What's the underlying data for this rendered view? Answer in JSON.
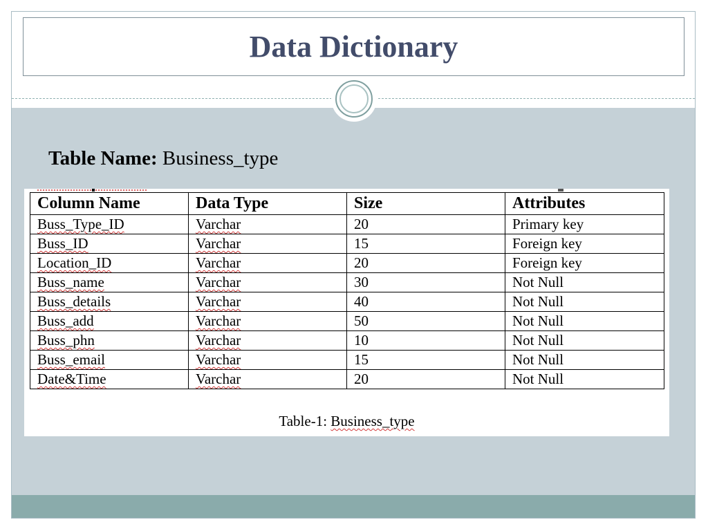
{
  "slide": {
    "title": "Data Dictionary",
    "table_name_label": "Table Name:",
    "table_name_value": "Business_type"
  },
  "table": {
    "headers": [
      "Column Name",
      "Data Type",
      "Size",
      "Attributes"
    ],
    "rows": [
      [
        "Buss_Type_ID",
        "Varchar",
        "20",
        "Primary key"
      ],
      [
        "Buss_ID",
        "Varchar",
        "15",
        "Foreign key"
      ],
      [
        "Location_ID",
        "Varchar",
        "20",
        "Foreign key"
      ],
      [
        "Buss_name",
        "Varchar",
        "30",
        "Not Null"
      ],
      [
        "Buss_details",
        "Varchar",
        "40",
        "Not Null"
      ],
      [
        "Buss_add",
        "Varchar",
        "50",
        "Not Null"
      ],
      [
        "Buss_phn",
        "Varchar",
        "10",
        "Not Null"
      ],
      [
        "Buss_email",
        "Varchar",
        "15",
        "Not Null"
      ],
      [
        "Date&Time",
        "Varchar",
        "20",
        "Not Null"
      ]
    ],
    "caption_prefix": "Table-1:",
    "caption_name": "Business_type"
  },
  "colors": {
    "title": "#424c6a",
    "content_background": "#c5d1d7",
    "footer_bar": "#8aabab",
    "spellcheck_underline": "#d13a3a"
  }
}
